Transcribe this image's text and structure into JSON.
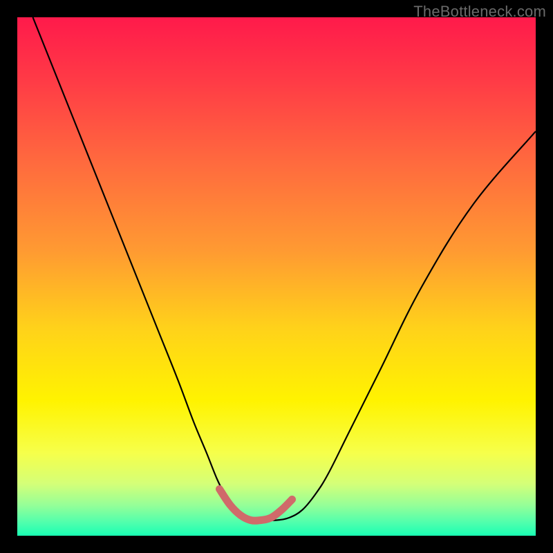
{
  "watermark": "TheBottleneck.com",
  "chart_data": {
    "type": "line",
    "title": "",
    "xlabel": "",
    "ylabel": "",
    "xlim": [
      0,
      100
    ],
    "ylim": [
      0,
      100
    ],
    "grid": false,
    "legend": false,
    "series": [
      {
        "name": "curve",
        "color": "#000000",
        "x": [
          3,
          7,
          11,
          15,
          19,
          23,
          27,
          31,
          34,
          36.5,
          38.5,
          40,
          41.5,
          43,
          45,
          47.5,
          50,
          52.5,
          55,
          57.5,
          60,
          64,
          70,
          78,
          88,
          100
        ],
        "y": [
          100,
          90,
          80,
          70,
          60,
          50,
          40,
          30,
          22,
          16,
          11,
          8,
          5.5,
          4,
          3,
          3,
          3,
          3.5,
          5,
          8,
          12,
          20,
          32,
          48,
          64,
          78
        ]
      },
      {
        "name": "flat-marker",
        "color": "#d06a6a",
        "x": [
          39,
          41,
          43,
          45,
          47,
          49,
          51,
          53
        ],
        "y": [
          9,
          6,
          4,
          3,
          3,
          3.5,
          5,
          7
        ]
      }
    ],
    "gradient_stops": [
      {
        "offset": 0.0,
        "color": "#ff1a4b"
      },
      {
        "offset": 0.12,
        "color": "#ff3a46"
      },
      {
        "offset": 0.28,
        "color": "#ff6a3e"
      },
      {
        "offset": 0.45,
        "color": "#ff9a32"
      },
      {
        "offset": 0.6,
        "color": "#ffd21a"
      },
      {
        "offset": 0.74,
        "color": "#fff300"
      },
      {
        "offset": 0.84,
        "color": "#f6ff4a"
      },
      {
        "offset": 0.9,
        "color": "#d4ff78"
      },
      {
        "offset": 0.94,
        "color": "#97ff97"
      },
      {
        "offset": 0.975,
        "color": "#4fffad"
      },
      {
        "offset": 1.0,
        "color": "#19ffb3"
      }
    ]
  }
}
